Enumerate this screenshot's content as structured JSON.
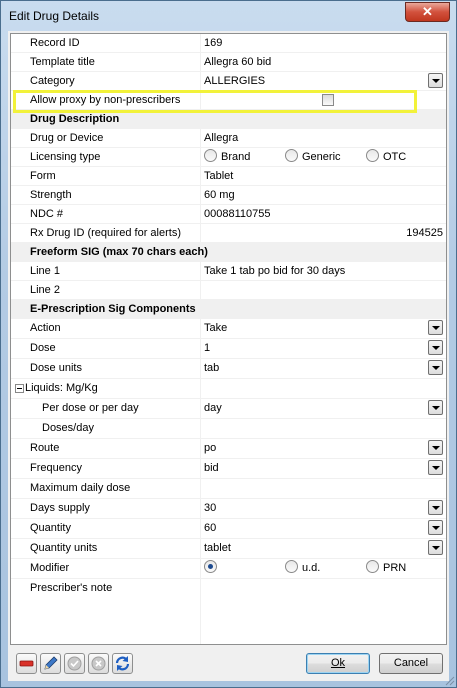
{
  "window": {
    "title": "Edit Drug Details",
    "close_glyph": "✕"
  },
  "fields": {
    "record_id": {
      "label": "Record ID",
      "value": "169"
    },
    "template_title": {
      "label": "Template title",
      "value": "Allegra 60 bid"
    },
    "category": {
      "label": "Category",
      "value": "ALLERGIES"
    },
    "allow_proxy": {
      "label": "Allow proxy by non-prescribers",
      "checked": false
    }
  },
  "sections": {
    "drug_description": "Drug Description",
    "freeform_sig": "Freeform SIG (max 70 chars each)",
    "eprescription": "E-Prescription Sig Components"
  },
  "drug": {
    "drug_or_device": {
      "label": "Drug or Device",
      "value": "Allegra"
    },
    "licensing_type": {
      "label": "Licensing type",
      "options": [
        "Brand",
        "Generic",
        "OTC"
      ],
      "selected": null
    },
    "form": {
      "label": "Form",
      "value": "Tablet"
    },
    "strength": {
      "label": "Strength",
      "value": "60 mg"
    },
    "ndc": {
      "label": "NDC #",
      "value": "00088110755"
    },
    "rx_drug_id": {
      "label": "Rx Drug ID (required for alerts)",
      "value": "194525"
    }
  },
  "sig": {
    "line1": {
      "label": "Line 1",
      "value": "Take 1 tab po bid for 30 days"
    },
    "line2": {
      "label": "Line 2",
      "value": ""
    }
  },
  "erx": {
    "action": {
      "label": "Action",
      "value": "Take"
    },
    "dose": {
      "label": "Dose",
      "value": "1"
    },
    "dose_units": {
      "label": "Dose units",
      "value": "tab"
    },
    "liquids": {
      "label": "Liquids: Mg/Kg"
    },
    "per_dose": {
      "label": "Per dose or per day",
      "value": "day"
    },
    "doses_day": {
      "label": "Doses/day",
      "value": ""
    },
    "route": {
      "label": "Route",
      "value": "po"
    },
    "frequency": {
      "label": "Frequency",
      "value": "bid"
    },
    "max_daily": {
      "label": "Maximum daily dose",
      "value": ""
    },
    "days_supply": {
      "label": "Days supply",
      "value": "30"
    },
    "quantity": {
      "label": "Quantity",
      "value": "60"
    },
    "quantity_units": {
      "label": "Quantity units",
      "value": "tablet"
    },
    "modifier": {
      "label": "Modifier",
      "options": [
        "",
        "u.d.",
        "PRN"
      ],
      "selected": 0
    },
    "prescriber_note": {
      "label": "Prescriber's note",
      "value": ""
    }
  },
  "buttons": {
    "ok": "Ok",
    "cancel": "Cancel"
  },
  "colors": {
    "highlight": "#f2f23a",
    "title_bg": "#b3cbe4",
    "section_bg": "#f0f0f0"
  }
}
